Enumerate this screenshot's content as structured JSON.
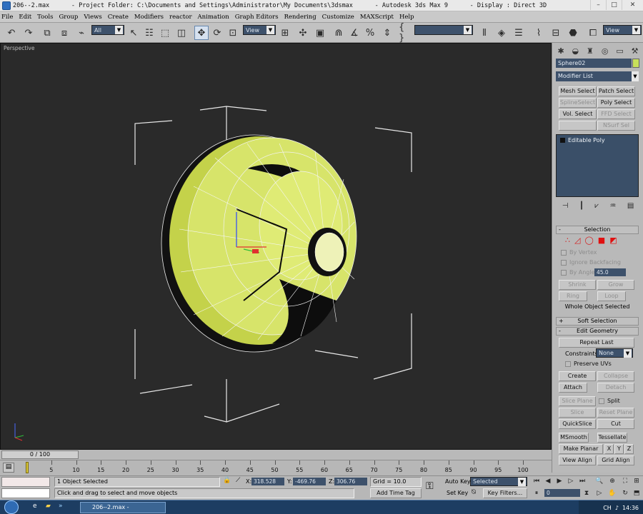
{
  "window": {
    "title": "206--2.max      - Project Folder: C:\\Documents and Settings\\Administrator\\My Documents\\3dsmax      - Autodesk 3ds Max 9      - Display : Direct 3D",
    "controls": [
      "–",
      "□",
      "✕"
    ]
  },
  "menu": [
    "File",
    "Edit",
    "Tools",
    "Group",
    "Views",
    "Create",
    "Modifiers",
    "reactor",
    "Animation",
    "Graph Editors",
    "Rendering",
    "Customize",
    "MAXScript",
    "Help"
  ],
  "toolbar": {
    "selection_filter": "All",
    "ref_coord": "View",
    "named_selection": "",
    "render_view": "View"
  },
  "viewport": {
    "label": "Perspective"
  },
  "command_panel": {
    "object_name": "Sphere02",
    "object_color": "#c8e05a",
    "modifier_list": "Modifier List",
    "modifier_buttons": [
      {
        "label": "Mesh Select",
        "enabled": true
      },
      {
        "label": "Patch Select",
        "enabled": true
      },
      {
        "label": "SplineSelect",
        "enabled": false
      },
      {
        "label": "Poly Select",
        "enabled": true
      },
      {
        "label": "Vol. Select",
        "enabled": true
      },
      {
        "label": "FFD Select",
        "enabled": false
      },
      {
        "label": "",
        "enabled": false
      },
      {
        "label": "NSurf Sel",
        "enabled": false
      }
    ],
    "stack_items": [
      "Editable Poly"
    ],
    "selection_rollout": {
      "title": "Selection",
      "sign": "-",
      "by_vertex": "By Vertex",
      "ignore_backfacing": "Ignore Backfacing",
      "by_angle": "By Angle:",
      "angle_value": "45.0",
      "shrink": "Shrink",
      "grow": "Grow",
      "ring": "Ring",
      "loop": "Loop",
      "status": "Whole Object Selected"
    },
    "soft_selection": {
      "title": "Soft Selection",
      "sign": "+"
    },
    "edit_geometry": {
      "title": "Edit Geometry",
      "sign": "-",
      "repeat_last": "Repeat Last",
      "constraints_label": "Constraints:",
      "constraints_value": "None",
      "preserve_uvs": "Preserve UVs",
      "create": "Create",
      "collapse": "Collapse",
      "attach": "Attach",
      "detach": "Detach",
      "slice_plane": "Slice Plane",
      "split": "Split",
      "slice": "Slice",
      "reset_plane": "Reset Plane",
      "quickslice": "QuickSlice",
      "cut": "Cut",
      "msmooth": "MSmooth",
      "tessellate": "Tessellate",
      "make_planar": "Make Planar",
      "x": "X",
      "y": "Y",
      "z": "Z",
      "view_align": "View Align",
      "grid_align": "Grid Align"
    }
  },
  "timeline": {
    "slider_label": "0 / 100",
    "ticks": [
      "5",
      "10",
      "15",
      "20",
      "25",
      "30",
      "35",
      "40",
      "45",
      "50",
      "55",
      "60",
      "65",
      "70",
      "75",
      "80",
      "85",
      "90",
      "95",
      "100"
    ]
  },
  "status": {
    "selected": "1 Object Selected",
    "prompt": "Click and drag to select and move objects",
    "x_label": "X:",
    "x_value": "318.528",
    "y_label": "Y:",
    "y_value": "-469.76",
    "z_label": "Z:",
    "z_value": "306.76",
    "grid": "Grid = 10.0",
    "add_time_tag": "Add Time Tag",
    "auto_key": "Auto Key",
    "auto_key_mode": "Selected",
    "set_key": "Set Key",
    "key_filters": "Key Filters...",
    "frame": "0"
  },
  "taskbar": {
    "items": [
      "206--2.max      -"
    ],
    "tray_lang": "CH",
    "clock": "14:36"
  }
}
